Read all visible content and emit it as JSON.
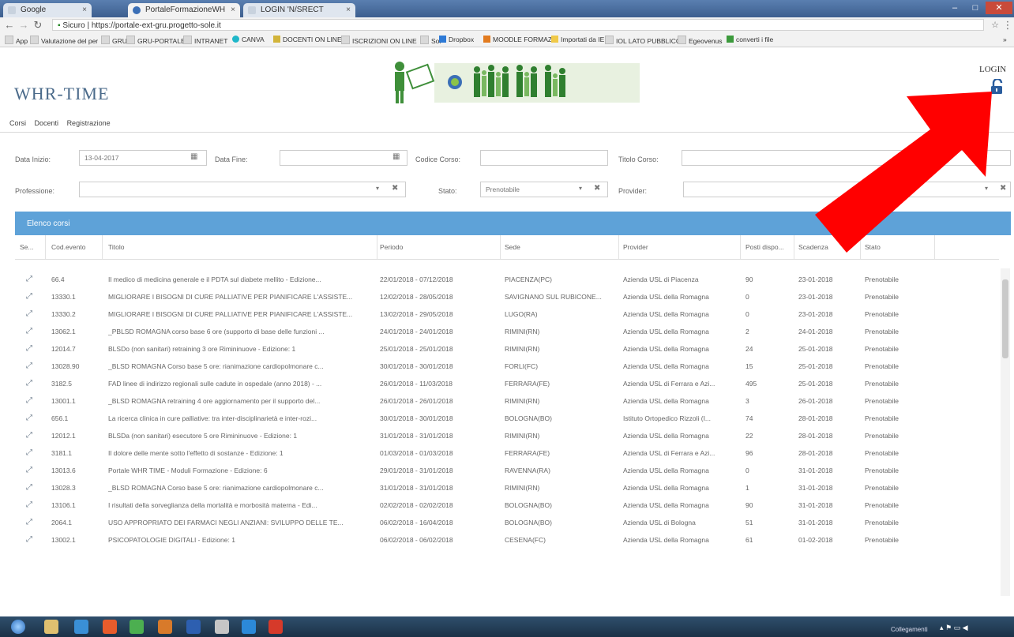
{
  "browser": {
    "tabs": [
      {
        "label": "Google"
      },
      {
        "label": "PortaleFormazioneWH"
      },
      {
        "label": "LOGIN 'N/SRECT"
      }
    ],
    "address": "Sicuro | https://portale-ext-gru.progetto-sole.it",
    "bookmarks": [
      "App",
      "Valutazione del per",
      "GRU",
      "GRU-PORTALE",
      "INTRANET",
      "CANVA",
      "DOCENTI ON LINE",
      "ISCRIZIONI ON LINE",
      "Sol",
      "Dropbox",
      "MOODLE FORMAZI",
      "Importati da IE",
      "IOL LATO PUBBLICO",
      "Egeovenus",
      "converti i file"
    ]
  },
  "header": {
    "site_title": "WHR-TIME",
    "login_label": "LOGIN",
    "menu": [
      "Corsi",
      "Docenti",
      "Registrazione"
    ]
  },
  "filters": {
    "data_inizio_label": "Data Inizio:",
    "data_inizio_value": "13-04-2017",
    "data_fine_label": "Data Fine:",
    "codice_corso_label": "Codice Corso:",
    "titolo_corso_label": "Titolo Corso:",
    "professione_label": "Professione:",
    "stato_label": "Stato:",
    "stato_value": "Prenotabile",
    "provider_label": "Provider:"
  },
  "table": {
    "title": "Elenco corsi",
    "columns": [
      "Se...",
      "Cod.evento",
      "Titolo",
      "Periodo",
      "Sede",
      "Provider",
      "Posti dispo...",
      "Scadenza",
      "Stato"
    ],
    "rows": [
      [
        "66.4",
        "Il medico di medicina generale e il PDTA sul diabete mellito - Edizione...",
        "22/01/2018 - 07/12/2018",
        "PIACENZA(PC)",
        "Azienda USL di Piacenza",
        "90",
        "23-01-2018",
        "Prenotabile"
      ],
      [
        "13330.1",
        "MIGLIORARE I BISOGNI DI CURE PALLIATIVE PER PIANIFICARE L'ASSISTE...",
        "12/02/2018 - 28/05/2018",
        "SAVIGNANO SUL RUBICONE...",
        "Azienda USL della Romagna",
        "0",
        "23-01-2018",
        "Prenotabile"
      ],
      [
        "13330.2",
        "MIGLIORARE I BISOGNI DI CURE PALLIATIVE PER PIANIFICARE L'ASSISTE...",
        "13/02/2018 - 29/05/2018",
        "LUGO(RA)",
        "Azienda USL della Romagna",
        "0",
        "23-01-2018",
        "Prenotabile"
      ],
      [
        "13062.1",
        "_PBLSD ROMAGNA corso base 6 ore (supporto di base delle funzioni ...",
        "24/01/2018 - 24/01/2018",
        "RIMINI(RN)",
        "Azienda USL della Romagna",
        "2",
        "24-01-2018",
        "Prenotabile"
      ],
      [
        "12014.7",
        "BLSDo (non sanitari) retraining 3 ore Rimininuove - Edizione: 1",
        "25/01/2018 - 25/01/2018",
        "RIMINI(RN)",
        "Azienda USL della Romagna",
        "24",
        "25-01-2018",
        "Prenotabile"
      ],
      [
        "13028.90",
        "_BLSD ROMAGNA Corso base 5 ore: rianimazione cardiopolmonare c...",
        "30/01/2018 - 30/01/2018",
        "FORLI(FC)",
        "Azienda USL della Romagna",
        "15",
        "25-01-2018",
        "Prenotabile"
      ],
      [
        "3182.5",
        "FAD linee di indirizzo regionali sulle cadute in ospedale (anno 2018) - ...",
        "26/01/2018 - 11/03/2018",
        "FERRARA(FE)",
        "Azienda USL di Ferrara e Azi...",
        "495",
        "25-01-2018",
        "Prenotabile"
      ],
      [
        "13001.1",
        "_BLSD ROMAGNA retraining 4 ore aggiornamento per il supporto del...",
        "26/01/2018 - 26/01/2018",
        "RIMINI(RN)",
        "Azienda USL della Romagna",
        "3",
        "26-01-2018",
        "Prenotabile"
      ],
      [
        "656.1",
        "La ricerca clinica in cure palliative: tra inter-disciplinarietà e inter-rozi...",
        "30/01/2018 - 30/01/2018",
        "BOLOGNA(BO)",
        "Istituto Ortopedico Rizzoli (I...",
        "74",
        "28-01-2018",
        "Prenotabile"
      ],
      [
        "12012.1",
        "BLSDa (non sanitari) esecutore 5 ore Rimininuove - Edizione: 1",
        "31/01/2018 - 31/01/2018",
        "RIMINI(RN)",
        "Azienda USL della Romagna",
        "22",
        "28-01-2018",
        "Prenotabile"
      ],
      [
        "3181.1",
        "Il dolore delle mente sotto l'effetto di sostanze - Edizione: 1",
        "01/03/2018 - 01/03/2018",
        "FERRARA(FE)",
        "Azienda USL di Ferrara e Azi...",
        "96",
        "28-01-2018",
        "Prenotabile"
      ],
      [
        "13013.6",
        "Portale WHR TIME - Moduli Formazione - Edizione: 6",
        "29/01/2018 - 31/01/2018",
        "RAVENNA(RA)",
        "Azienda USL della Romagna",
        "0",
        "31-01-2018",
        "Prenotabile"
      ],
      [
        "13028.3",
        "_BLSD ROMAGNA Corso base 5 ore: rianimazione cardiopolmonare c...",
        "31/01/2018 - 31/01/2018",
        "RIMINI(RN)",
        "Azienda USL della Romagna",
        "1",
        "31-01-2018",
        "Prenotabile"
      ],
      [
        "13106.1",
        "I risultati della sorveglianza della mortalità e morbosità materna - Edi...",
        "02/02/2018 - 02/02/2018",
        "BOLOGNA(BO)",
        "Azienda USL della Romagna",
        "90",
        "31-01-2018",
        "Prenotabile"
      ],
      [
        "2064.1",
        "USO APPROPRIATO DEI FARMACI NEGLI ANZIANI: SVILUPPO DELLE TE...",
        "06/02/2018 - 16/04/2018",
        "BOLOGNA(BO)",
        "Azienda USL di Bologna",
        "51",
        "31-01-2018",
        "Prenotabile"
      ],
      [
        "13002.1",
        "PSICOPATOLOGIE DIGITALI - Edizione: 1",
        "06/02/2018 - 06/02/2018",
        "CESENA(FC)",
        "Azienda USL della Romagna",
        "61",
        "01-02-2018",
        "Prenotabile"
      ]
    ]
  },
  "taskbar": {
    "tray_label": "Collegamenti"
  },
  "colors": {
    "list_bar": "#5ea2d8",
    "arrow": "#ff0000"
  }
}
